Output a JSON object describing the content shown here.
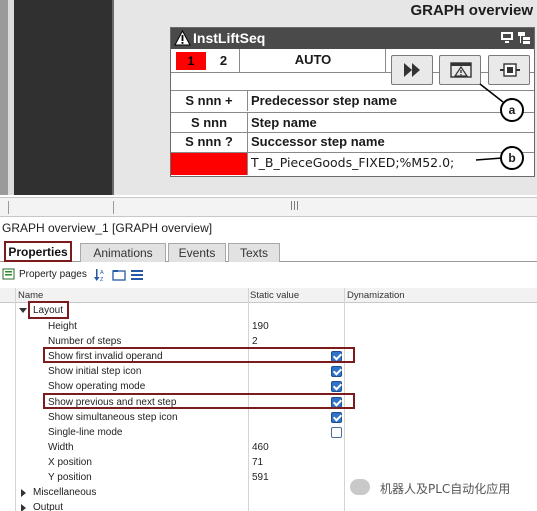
{
  "graph_overview": {
    "title": "GRAPH overview",
    "widget_name": "InstLiftSeq",
    "steps": [
      "1",
      "2"
    ],
    "mode": "AUTO",
    "rows": [
      {
        "left": "S nnn +",
        "right": "Predecessor step name"
      },
      {
        "left": "S nnn",
        "right": "Step name"
      },
      {
        "left": "S nnn ?",
        "right": "Successor step name"
      }
    ],
    "operand": "T_B_PieceGoods_FIXED;%M52.0;",
    "callouts": [
      "a",
      "b"
    ],
    "colors": {
      "active_step": "#ff0000",
      "header": "#4a4a4a"
    }
  },
  "panel": {
    "title": "GRAPH overview_1 [GRAPH overview]",
    "tabs": [
      "Properties",
      "Animations",
      "Events",
      "Texts"
    ],
    "active_tab": "Properties",
    "toolbar": {
      "property_pages": "Property pages"
    },
    "columns": {
      "name": "Name",
      "static_value": "Static value",
      "dynamization": "Dynamization"
    },
    "category_layout": "Layout",
    "properties": [
      {
        "name": "Height",
        "value": "190"
      },
      {
        "name": "Number of steps",
        "value": "2"
      },
      {
        "name": "Show first invalid operand",
        "checked": true
      },
      {
        "name": "Show initial step icon",
        "checked": true
      },
      {
        "name": "Show operating mode",
        "checked": true
      },
      {
        "name": "Show previous and next step",
        "checked": true
      },
      {
        "name": "Show simultaneous step icon",
        "checked": true
      },
      {
        "name": "Single-line mode",
        "checked": false
      },
      {
        "name": "Width",
        "value": "460"
      },
      {
        "name": "X position",
        "value": "71"
      },
      {
        "name": "Y position",
        "value": "591"
      }
    ],
    "category_misc": "Miscellaneous",
    "category_output": "Output"
  },
  "watermark": "机器人及PLC自动化应用"
}
